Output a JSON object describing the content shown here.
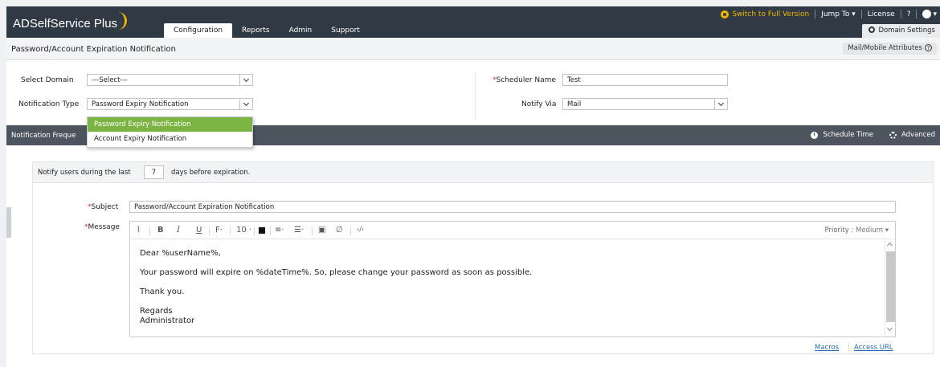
{
  "app": {
    "logo": "ADSelfService Plus",
    "tabs": [
      {
        "label": "Configuration",
        "active": true
      },
      {
        "label": "Reports"
      },
      {
        "label": "Admin"
      },
      {
        "label": "Support"
      }
    ],
    "switch_full": "Switch to Full Version",
    "jump_to": "Jump To",
    "license": "License",
    "help": "?",
    "domain_settings": "Domain Settings"
  },
  "page": {
    "title": "Password/Account Expiration Notification",
    "mail_attributes": "Mail/Mobile Attributes"
  },
  "form": {
    "select_domain_label": "Select Domain",
    "select_domain_value": "---Select---",
    "notification_type_label": "Notification Type",
    "notification_type_value": "Password Expiry Notification",
    "scheduler_name_label": "Scheduler Name",
    "scheduler_name_value": "Test",
    "notify_via_label": "Notify Via",
    "notify_via_value": "Mail"
  },
  "dropdown": {
    "options": [
      "Password Expiry Notification",
      "Account Expiry Notification"
    ]
  },
  "band": {
    "title": "Notification Freque",
    "schedule_time": "Schedule Time",
    "advanced": "Advanced"
  },
  "notify": {
    "prefix": "Notify users during the last",
    "days": "7",
    "suffix": "days before expiration."
  },
  "message": {
    "subject_label": "Subject",
    "subject_value": "Password/Account Expiration Notification",
    "message_label": "Message",
    "priority_label": "Priority :",
    "priority_value": "Medium",
    "font_size": "10",
    "lines": [
      "Dear %userName%,",
      "Your password will expire on %dateTime%. So, please change your password as soon as possible.",
      "Thank you.",
      "Regards",
      "Administrator"
    ],
    "macros": "Macros",
    "access_url": "Access URL"
  },
  "colors": {
    "topbar": "#2f3a44",
    "accent_gold": "#f2b400",
    "band": "#4c545d",
    "selected_option": "#7cb443",
    "link": "#2a6ebb"
  }
}
